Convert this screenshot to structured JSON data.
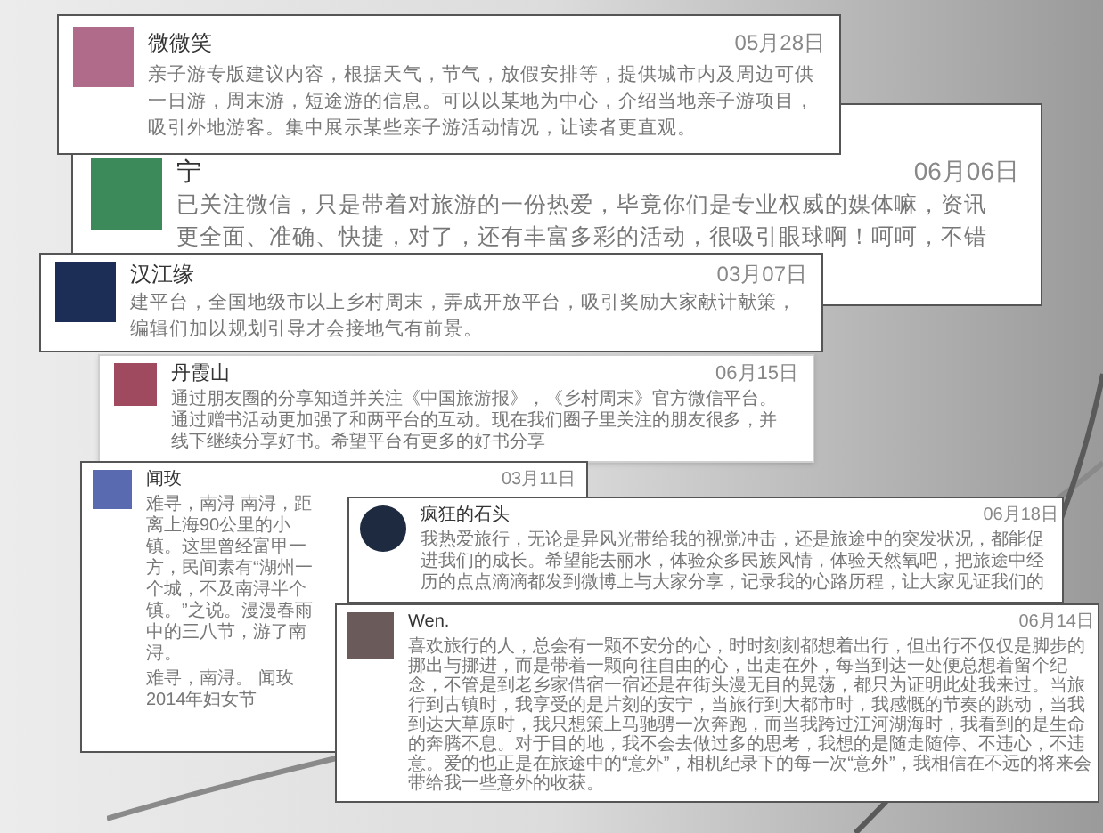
{
  "cards": [
    {
      "name": "微微笑",
      "date": "05月28日",
      "body": "亲子游专版建议内容，根据天气，节气，放假安排等，提供城市内及周边可供一日游，周末游，短途游的信息。可以以某地为中心，介绍当地亲子游项目，吸引外地游客。集中展示某些亲子游活动情况，让读者更直观。"
    },
    {
      "name": "宁",
      "date": "06月06日",
      "body": "已关注微信，只是带着对旅游的一份热爱，毕竟你们是专业权威的媒体嘛，资讯更全面、准确、快捷，对了，还有丰富多彩的活动，很吸引眼球啊！呵呵，不错"
    },
    {
      "name": "汉江缘",
      "date": "03月07日",
      "body": "建平台，全国地级市以上乡村周末，弄成开放平台，吸引奖励大家献计献策，编辑们加以规划引导才会接地气有前景。"
    },
    {
      "name": "丹霞山",
      "date": "06月15日",
      "body": "通过朋友圈的分享知道并关注《中国旅游报》，《乡村周末》官方微信平台。通过赠书活动更加强了和两平台的互动。现在我们圈子里关注的朋友很多，并线下继续分享好书。希望平台有更多的好书分享"
    },
    {
      "name": "闻玫",
      "date": "03月11日",
      "body": "难寻，南浔 南浔，距离上海90公里的小镇。这里曾经富甲一方，民间素有“湖州一个城，不及南浔半个镇。”之说。漫漫春雨中的三八节，游了南浔。",
      "closing": "难寻，南浔。 闻玫2014年妇女节"
    },
    {
      "name": "疯狂的石头",
      "date": "06月18日",
      "body": "我热爱旅行，无论是异风光带给我的视觉冲击，还是旅途中的突发状况，都能促进我们的成长。希望能去丽水，体验众多民族风情，体验天然氧吧，把旅途中经历的点点滴滴都发到微博上与大家分享，记录我的心路历程，让大家见证我们的"
    },
    {
      "name": "Wen.",
      "date": "06月14日",
      "body": "喜欢旅行的人，总会有一颗不安分的心，时时刻刻都想着出行，但出行不仅仅是脚步的挪出与挪进，而是带着一颗向往自由的心，出走在外，每当到达一处便总想着留个纪念，不管是到老乡家借宿一宿还是在街头漫无目的晃荡，都只为证明此处我来过。当旅行到古镇时，我享受的是片刻的安宁，当旅行到大都市时，我感慨的节奏的跳动，当我到达大草原时，我只想策上马驰骋一次奔跑，而当我跨过江河湖海时，我看到的是生命的奔腾不息。对于目的地，我不会去做过多的思考，我想的是随走随停、不违心，不违意。爱的也正是在旅途中的“意外”，相机纪录下的每一次“意外”，我相信在不远的将来会带给我一些意外的收获。"
    }
  ]
}
